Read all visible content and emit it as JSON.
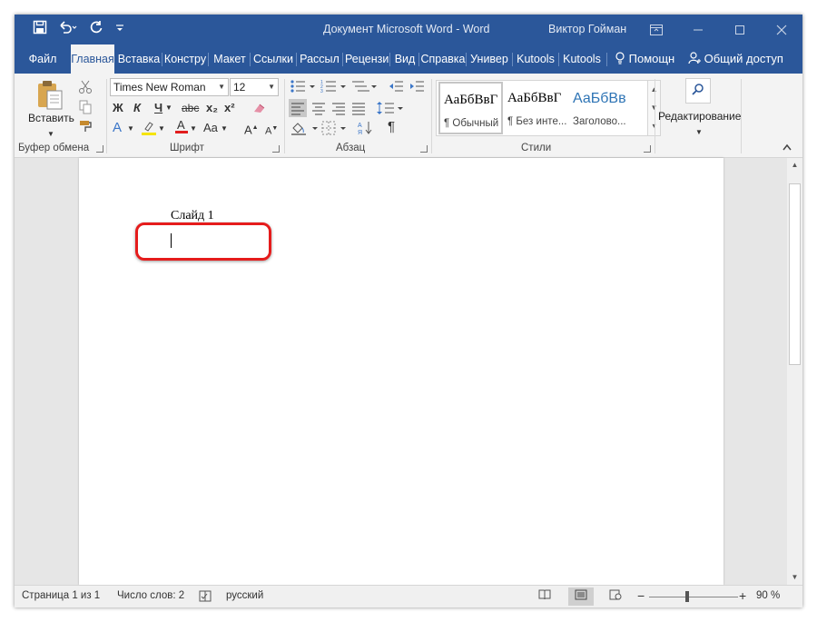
{
  "window": {
    "title": "Документ Microsoft Word  -  Word",
    "user": "Виктор Гойман"
  },
  "tabs": [
    "Файл",
    "Главная",
    "Вставка",
    "Констру",
    "Макет",
    "Ссылки",
    "Рассыл",
    "Рецензи",
    "Вид",
    "Справка",
    "Универ",
    "Kutools",
    "Kutools"
  ],
  "tell_me": "Помощн",
  "share": "Общий доступ",
  "ribbon": {
    "clipboard": {
      "paste_label": "Вставить",
      "group_label": "Буфер обмена"
    },
    "font": {
      "font_name": "Times New Roman",
      "font_size": "12",
      "group_label": "Шрифт",
      "bold": "Ж",
      "italic": "К",
      "underline": "Ч",
      "strike": "abc",
      "subscript": "x₂",
      "superscript": "x²",
      "case": "Aa"
    },
    "paragraph": {
      "group_label": "Абзац",
      "pilcrow": "¶"
    },
    "styles": {
      "group_label": "Стили",
      "items": [
        {
          "sample": "АаБбВвГ",
          "name": "¶ Обычный"
        },
        {
          "sample": "АаБбВвГ",
          "name": "¶ Без инте..."
        },
        {
          "sample": "АаБбВв",
          "name": "Заголово..."
        }
      ]
    },
    "editing": {
      "label": "Редактирование"
    }
  },
  "document": {
    "text": "Слайд 1"
  },
  "status": {
    "page": "Страница 1 из 1",
    "words": "Число слов: 2",
    "language": "русский",
    "zoom": "90 %",
    "zoom_percent": 90
  },
  "colors": {
    "accent": "#2b579a",
    "highlight": "#e51c1c"
  }
}
